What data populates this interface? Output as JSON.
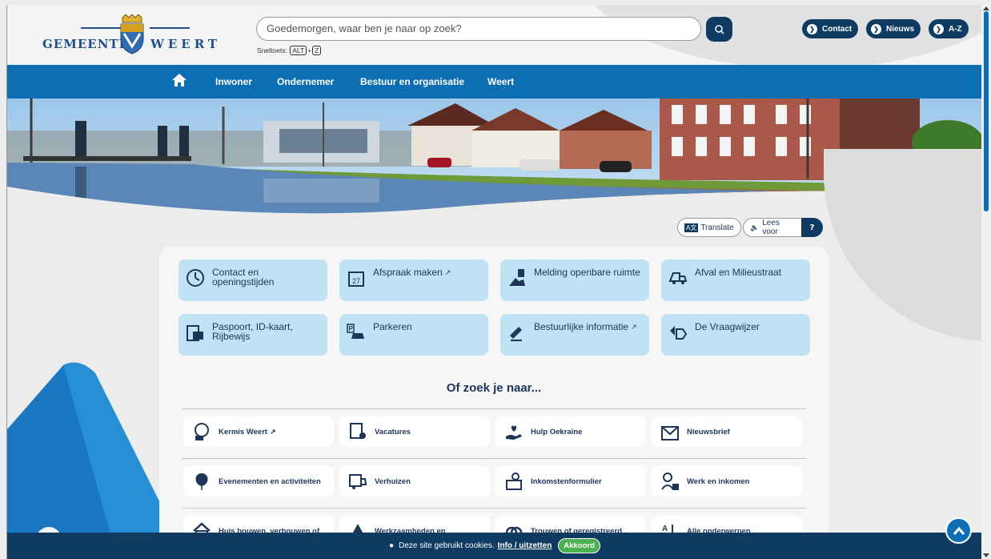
{
  "header": {
    "logo_left": "GEMEENTE",
    "logo_right": "WEERT",
    "search_placeholder": "Goedemorgen, waar ben je naar op zoek?",
    "shortcut_label": "Sneltoets:",
    "shortcut_key1": "ALT",
    "shortcut_plus": "+",
    "shortcut_key2": "Z",
    "buttons": [
      "Contact",
      "Nieuws",
      "A-Z"
    ]
  },
  "nav": {
    "items": [
      "Inwoner",
      "Ondernemer",
      "Bestuur en organisatie",
      "Weert"
    ]
  },
  "utility": {
    "translate": "Translate",
    "translate_badge": "A文",
    "lees_voor": "Lees voor",
    "help": "?"
  },
  "tiles": [
    {
      "label": "Contact en openingstijden",
      "icon": "clock-icon"
    },
    {
      "label": "Afspraak maken",
      "icon": "calendar-icon",
      "external": true
    },
    {
      "label": "Melding openbare ruimte",
      "icon": "report-icon"
    },
    {
      "label": "Afval en Milieustraat",
      "icon": "truck-icon"
    },
    {
      "label": "Paspoort, ID-kaart, Rijbewijs",
      "icon": "id-card-icon"
    },
    {
      "label": "Parkeren",
      "icon": "parking-icon"
    },
    {
      "label": "Bestuurlijke informatie",
      "icon": "gavel-icon",
      "external": true
    },
    {
      "label": "De Vraagwijzer",
      "icon": "signpost-icon"
    }
  ],
  "section": {
    "heading": "Of zoek je naar..."
  },
  "links": [
    {
      "label": "Kermis Weert",
      "icon": "ferris-wheel-icon",
      "external": true
    },
    {
      "label": "Vacatures",
      "icon": "cv-icon"
    },
    {
      "label": "Hulp Oekraïne",
      "icon": "heart-hand-icon"
    },
    {
      "label": "Nieuwsbrief",
      "icon": "envelope-icon"
    },
    {
      "label": "Evenementen en activiteiten",
      "icon": "balloon-icon"
    },
    {
      "label": "Verhuizen",
      "icon": "moving-truck-icon"
    },
    {
      "label": "Inkomstenformulier",
      "icon": "form-icon"
    },
    {
      "label": "Werk en inkomen",
      "icon": "work-icon"
    },
    {
      "label": "Huis bouwen, verbouwen of",
      "icon": "house-icon"
    },
    {
      "label": "Werkzaamheden en",
      "icon": "roadwork-icon"
    },
    {
      "label": "Trouwen of geregistreerd",
      "icon": "rings-icon"
    },
    {
      "label": "Alle onderwerpen",
      "icon": "az-icon"
    }
  ],
  "cookie": {
    "text": "Deze site gebruikt cookies.",
    "link": "Info / uitzetten",
    "accept": "Akkoord"
  },
  "colors": {
    "nav_blue": "#0e6eb4",
    "dark_blue": "#0f3b63",
    "tile_blue": "#bfe3f4",
    "accept_green": "#4caf50"
  }
}
